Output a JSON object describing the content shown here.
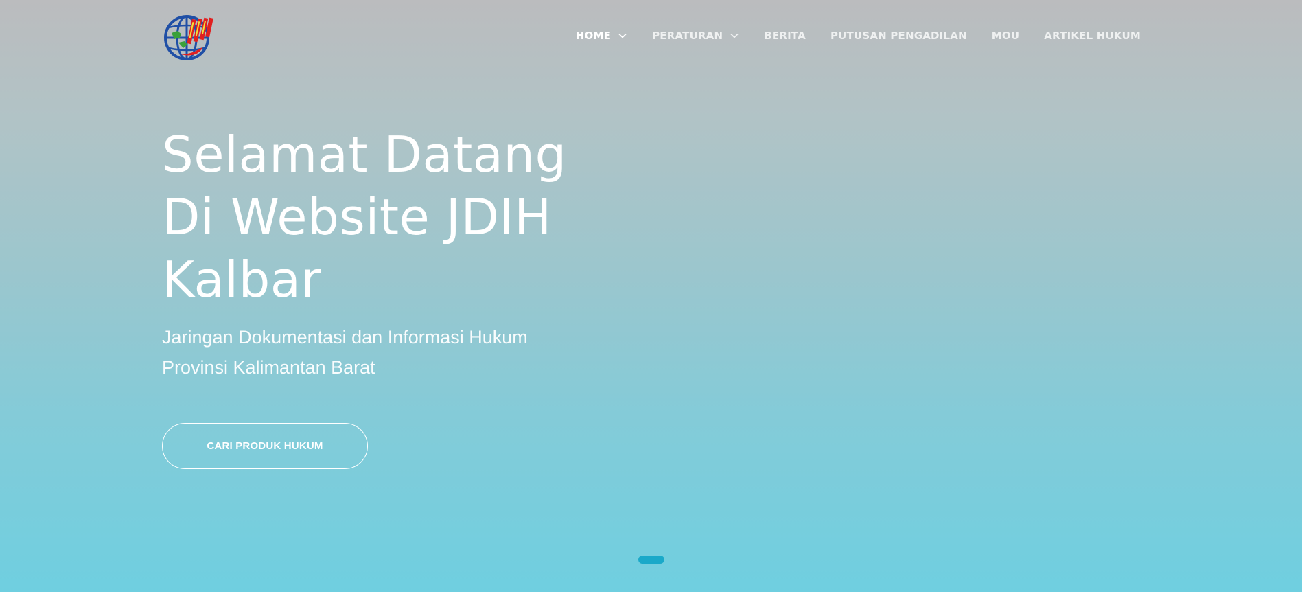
{
  "header": {
    "logo_text": "JDIH",
    "nav": [
      {
        "label": "HOME",
        "has_dropdown": true,
        "active": true
      },
      {
        "label": "PERATURAN",
        "has_dropdown": true,
        "active": false
      },
      {
        "label": "BERITA",
        "has_dropdown": false,
        "active": false
      },
      {
        "label": "PUTUSAN PENGADILAN",
        "has_dropdown": false,
        "active": false
      },
      {
        "label": "MOU",
        "has_dropdown": false,
        "active": false
      },
      {
        "label": "ARTIKEL HUKUM",
        "has_dropdown": false,
        "active": false
      }
    ]
  },
  "hero": {
    "title_lines": [
      "Selamat Datang",
      "Di Website JDIH",
      "Kalbar"
    ],
    "subtitle_lines": [
      "Jaringan Dokumentasi dan Informasi Hukum",
      "Provinsi Kalimantan Barat"
    ],
    "cta_label": "CARI PRODUK HUKUM"
  },
  "carousel": {
    "active_index": 0,
    "count": 1
  },
  "colors": {
    "accent": "#1aa9c9",
    "text": "#ffffff",
    "logo_blue": "#1f4fa6",
    "logo_red": "#e02020",
    "logo_green": "#3aa03a"
  },
  "icons": {
    "dropdown": "chevron-down-icon",
    "logo": "globe-logo-icon"
  }
}
